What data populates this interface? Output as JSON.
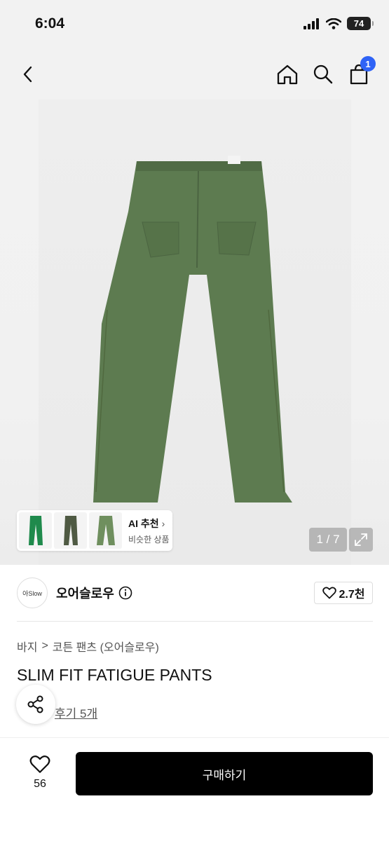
{
  "status_bar": {
    "time": "6:04",
    "battery": "74"
  },
  "nav": {
    "cart_count": "1"
  },
  "gallery": {
    "counter": "1 / 7",
    "ai_card": {
      "title": "AI 추천",
      "chevron": "›",
      "subtitle": "비슷한 상품"
    },
    "thumb_colors": [
      "#1f8a4c",
      "#4f5a43",
      "#6f8f5e"
    ],
    "product_color": "#5b7a4e"
  },
  "store": {
    "logo_text": "아Slow",
    "name": "오어슬로우",
    "likes": "2.7천"
  },
  "breadcrumb": {
    "level1": "바지",
    "separator": ">",
    "level2": "코튼 팬츠 (오어슬로우)"
  },
  "product": {
    "title": "SLIM FIT FATIGUE PANTS",
    "review_link": "후기 5개"
  },
  "bottom_bar": {
    "wish_count": "56",
    "buy_label": "구매하기"
  }
}
